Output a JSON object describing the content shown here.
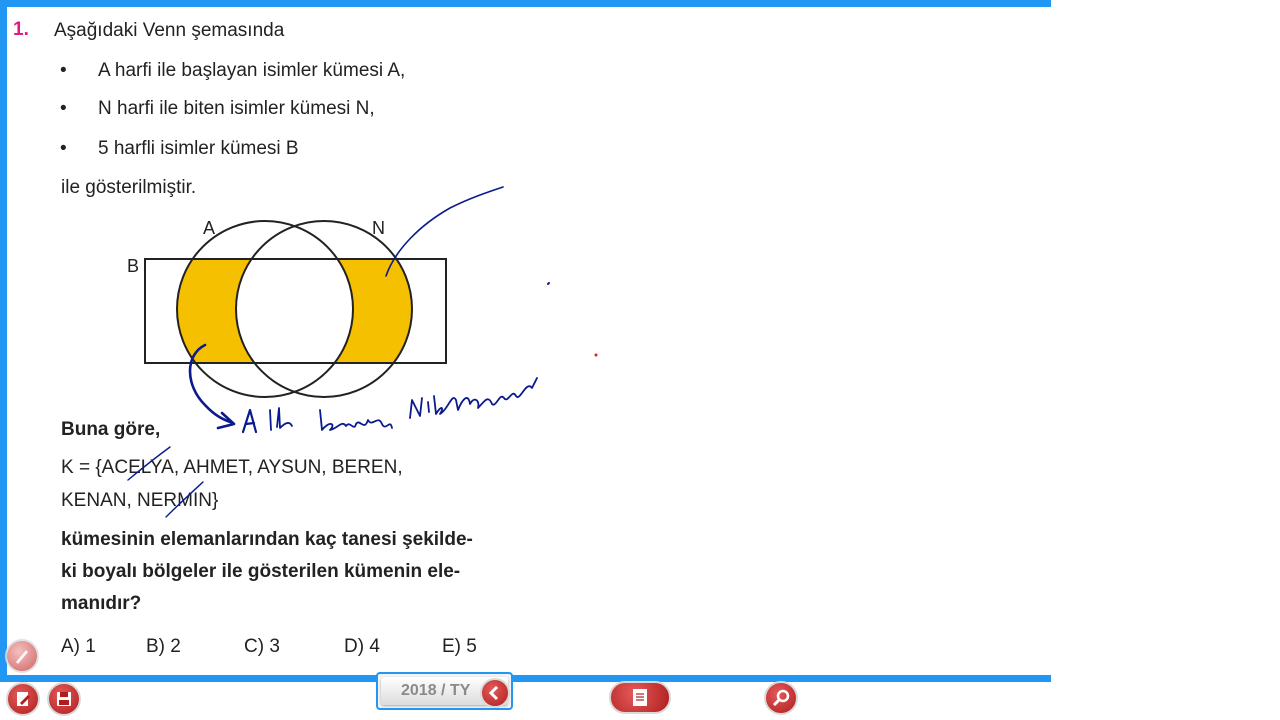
{
  "question": {
    "number": "1.",
    "intro": "Aşağıdaki Venn şemasında",
    "bullets": [
      {
        "dot": "•",
        "text": "A harfi ile başlayan isimler kümesi A,"
      },
      {
        "dot": "•",
        "text": "N harfi ile biten isimler kümesi N,"
      },
      {
        "dot": "•",
        "text": "5 harfli isimler kümesi B"
      }
    ],
    "shown_line": "ile gösterilmiştir.",
    "venn": {
      "label_a": "A",
      "label_n": "N",
      "label_b": "B",
      "shade_color": "#f5c000"
    },
    "prompt": "Buna göre,",
    "set_line1": "K = {ACELYA, AHMET, AYSUN, BEREN,",
    "set_line2": "KENAN, NERMIN}",
    "ask_line1": "kümesinin elemanlarından kaç tanesi şekilde-",
    "ask_line2": "ki boyalı bölgeler ile gösterilen kümenin ele-",
    "ask_line3": "manıdır?",
    "answers": [
      "A) 1",
      "B) 2",
      "C) 3",
      "D) 4",
      "E) 5"
    ]
  },
  "handwriting": {
    "note": "A ile başlayan N ile biten",
    "ink_color": "#0b1a8c"
  },
  "toolbar": {
    "year_label": "2018 / TY",
    "accent_color": "#2196f3",
    "icons": [
      "edit-icon",
      "save-icon",
      "back-icon",
      "document-icon",
      "search-icon",
      "pen-tool-icon"
    ]
  }
}
